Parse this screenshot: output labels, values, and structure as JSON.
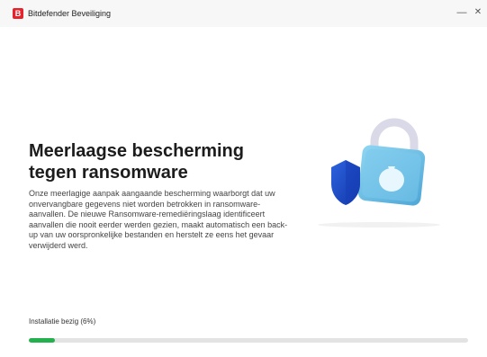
{
  "window": {
    "title": "Bitdefender Beveiliging",
    "logo_letter": "B",
    "minimize_glyph": "—",
    "close_glyph": "✕"
  },
  "content": {
    "headline": "Meerlaagse bescherming tegen ransomware",
    "description": "Onze meerlagige aanpak aangaande bescherming waarborgt dat uw onvervangbare gegevens niet worden betrokken in ransomware-aanvallen. De nieuwe Ransomware-remediëringslaag identificeert aanvallen die nooit eerder werden gezien, maakt automatisch een back-up van uw oorspronkelijke bestanden en herstelt ze eens het gevaar verwijderd werd."
  },
  "install": {
    "label": "Installatie bezig (6%)",
    "progress_percent": 6
  },
  "icons": {
    "logo": "bitdefender-logo",
    "illustration": "padlock-shield-illustration"
  },
  "colors": {
    "brand": "#e5232d",
    "progress": "#22b14c",
    "shield": "#1f4fc7",
    "lock_body": "#6ec3e8"
  }
}
